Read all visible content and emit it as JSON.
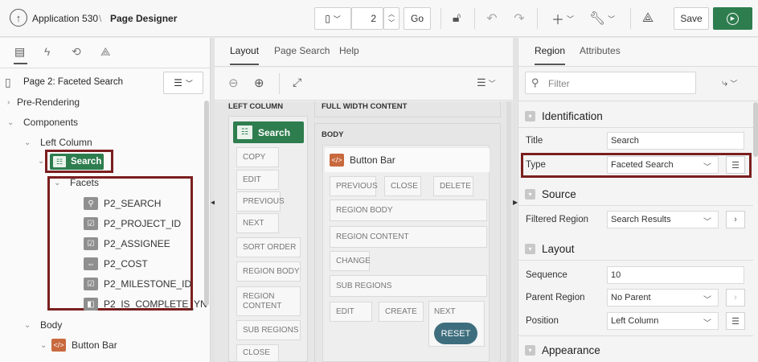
{
  "header": {
    "app_name": "Application 530",
    "separator": "\\",
    "page_designer": "Page Designer",
    "page_number": "2",
    "go_label": "Go",
    "save_label": "Save"
  },
  "left_panel": {
    "page_title": "Page 2: Faceted Search",
    "tree": {
      "pre_rendering": "Pre-Rendering",
      "components": "Components",
      "left_column": "Left Column",
      "search": "Search",
      "facets": "Facets",
      "facet_items": [
        "P2_SEARCH",
        "P2_PROJECT_ID",
        "P2_ASSIGNEE",
        "P2_COST",
        "P2_MILESTONE_ID",
        "P2_IS_COMPLETE_YN"
      ],
      "body": "Body",
      "button_bar": "Button Bar"
    }
  },
  "middle_panel": {
    "tabs": [
      "Layout",
      "Page Search",
      "Help"
    ],
    "left_column_header": "LEFT COLUMN",
    "full_width_header": "FULL WIDTH CONTENT",
    "body_header": "BODY",
    "search_region": "Search",
    "left_slots": [
      "COPY",
      "EDIT",
      "PREVIOUS",
      "NEXT",
      "SORT ORDER",
      "REGION BODY",
      "REGION CONTENT",
      "SUB REGIONS",
      "CLOSE"
    ],
    "button_bar_region": "Button Bar",
    "bb_row1": [
      "PREVIOUS",
      "CLOSE",
      "DELETE"
    ],
    "bb_region_body": "REGION BODY",
    "bb_region_content": "REGION CONTENT",
    "bb_change": "CHANGE",
    "bb_sub_regions": "SUB REGIONS",
    "bb_row_last": [
      "EDIT",
      "CREATE",
      "NEXT"
    ],
    "reset_label": "RESET"
  },
  "right_panel": {
    "tabs": [
      "Region",
      "Attributes"
    ],
    "filter_placeholder": "Filter",
    "identification": {
      "header": "Identification",
      "title_label": "Title",
      "title_value": "Search",
      "type_label": "Type",
      "type_value": "Faceted Search"
    },
    "source": {
      "header": "Source",
      "filtered_region_label": "Filtered Region",
      "filtered_region_value": "Search Results"
    },
    "layout": {
      "header": "Layout",
      "sequence_label": "Sequence",
      "sequence_value": "10",
      "parent_region_label": "Parent Region",
      "parent_region_value": "No Parent",
      "position_label": "Position",
      "position_value": "Left Column"
    },
    "appearance": {
      "header": "Appearance"
    }
  },
  "colors": {
    "accent_green": "#2e7d4f",
    "highlight_red": "#7a1f1f",
    "reset_teal": "#3e6e7e"
  }
}
